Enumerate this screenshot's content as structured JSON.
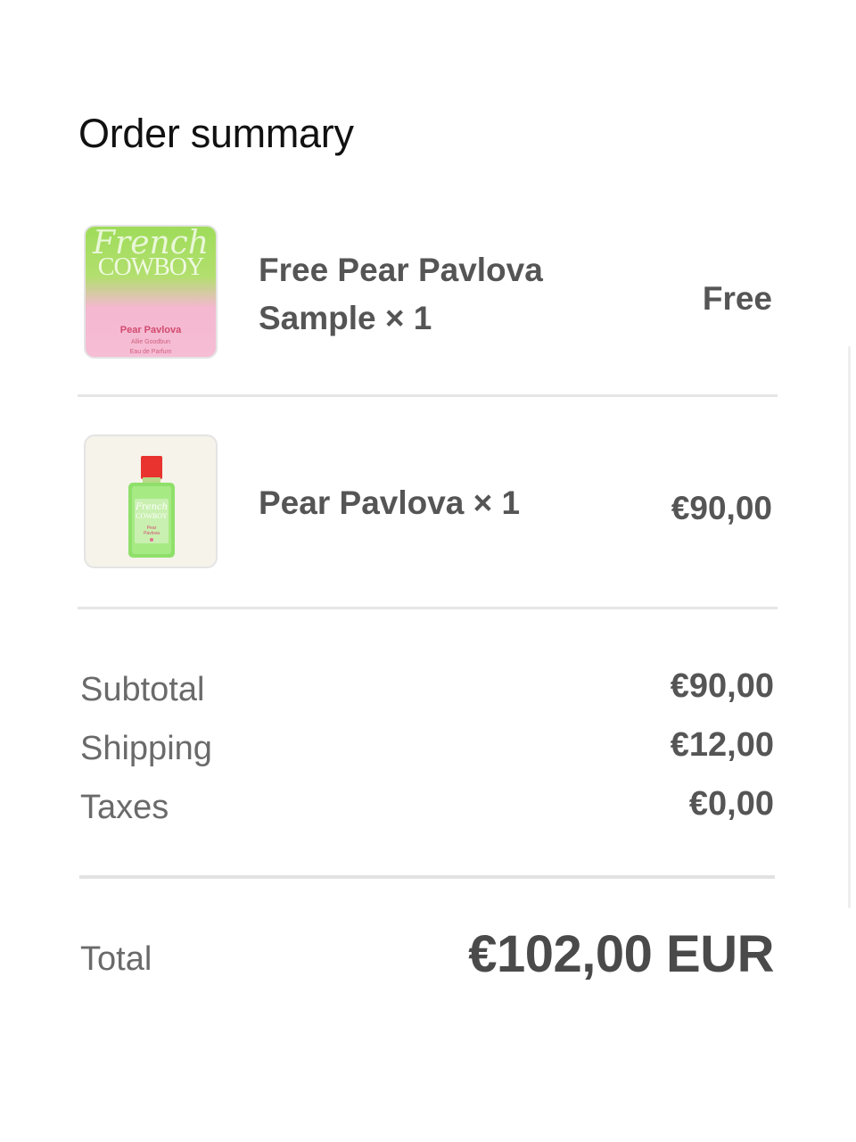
{
  "header": {
    "title": "Order summary"
  },
  "items": [
    {
      "name": "Free Pear Pavlova Sample × 1",
      "price": "Free",
      "thumbnail": {
        "brand_script": "French",
        "brand_caps": "COWBOY",
        "product": "Pear Pavlova",
        "perfumer": "Allie Goodbun",
        "type": "Eau de Parfum"
      }
    },
    {
      "name": "Pear Pavlova × 1",
      "price": "€90,00",
      "thumbnail": {
        "icon": "perfume-bottle-icon"
      }
    }
  ],
  "summary": {
    "subtotal_label": "Subtotal",
    "subtotal_value": "€90,00",
    "shipping_label": "Shipping",
    "shipping_value": "€12,00",
    "taxes_label": "Taxes",
    "taxes_value": "€0,00"
  },
  "total": {
    "label": "Total",
    "value": "€102,00 EUR"
  },
  "colors": {
    "sample_green": "#9fdc5a",
    "sample_pink": "#f6bdd5",
    "bottle_cap": "#e8332f",
    "bottle_glass": "#8fe06a"
  }
}
